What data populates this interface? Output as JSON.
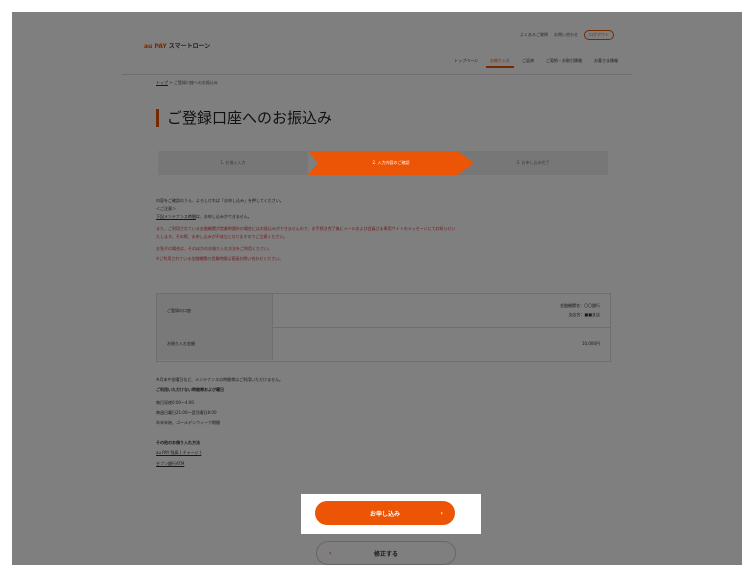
{
  "header": {
    "brand_prefix": "au PAY",
    "brand_suffix": "スマートローン",
    "links": [
      "よくあるご質問",
      "お問い合わせ"
    ],
    "logout_label": "ログアウト",
    "nav": [
      "トップページ",
      "お借り入れ",
      "ご返済",
      "ご契約・お取引情報",
      "お客さま情報"
    ],
    "active_nav_index": 1
  },
  "breadcrumb": {
    "top": "トップ",
    "separator": " > ",
    "current": "ご登録口座へのお振込み"
  },
  "page_title": "ご登録口座へのお振込み",
  "steps": [
    {
      "label": "1. お借入入力"
    },
    {
      "label": "2. 入力内容のご確認"
    },
    {
      "label": "3. お申し込み完了"
    }
  ],
  "notices": {
    "line1": "内容をご確認のうえ、よろしければ「お申し込み」を押してください。",
    "line2": "＜ご注意＞",
    "line3_link": "下記メンテナンス時間",
    "line3_rest": "は、お申し込みができません。",
    "red1": "また、ご利用されている金融機関が営業時間外の場合にはお振込みができませんので、お手続き完了後にメールおよび会員さま専用サイトのメッセージにてお知らせい",
    "red2": "たします。その際、お申し込みが不成立となりますのでご注意ください。",
    "red3": "お急ぎの場合は、そのほかのお借り入れ方法をご利用ください。",
    "red4": "※ご利用されている金融機関の営業時間は直接お問い合わせください。"
  },
  "table": {
    "row1_head": "ご登録の口座",
    "row1_bank": "金融機関名：〇〇銀行",
    "row1_branch": "支店名：■■支店",
    "row2_head": "お借り入れ金額",
    "row2_value": "10,000円"
  },
  "footer": {
    "note": "※月末や金曜日など、メンテナンスの時間帯はご利用いただけません。",
    "maint_title": "ご利用いただけない時間帯および曜日",
    "maint_1": "毎日深夜0:00〜4:00",
    "maint_2": "毎週日曜日21:00〜翌月曜日8:00",
    "maint_3": "年末年始、ゴールデンウィーク期間",
    "other_title": "その他のお借り入れ方法",
    "other_1": "au PAY 残高 ( チャージ )",
    "other_2": "セブン銀行ATM"
  },
  "buttons": {
    "apply": "お申し込み",
    "fix": "修正する"
  },
  "colors": {
    "accent": "#eb5505"
  }
}
